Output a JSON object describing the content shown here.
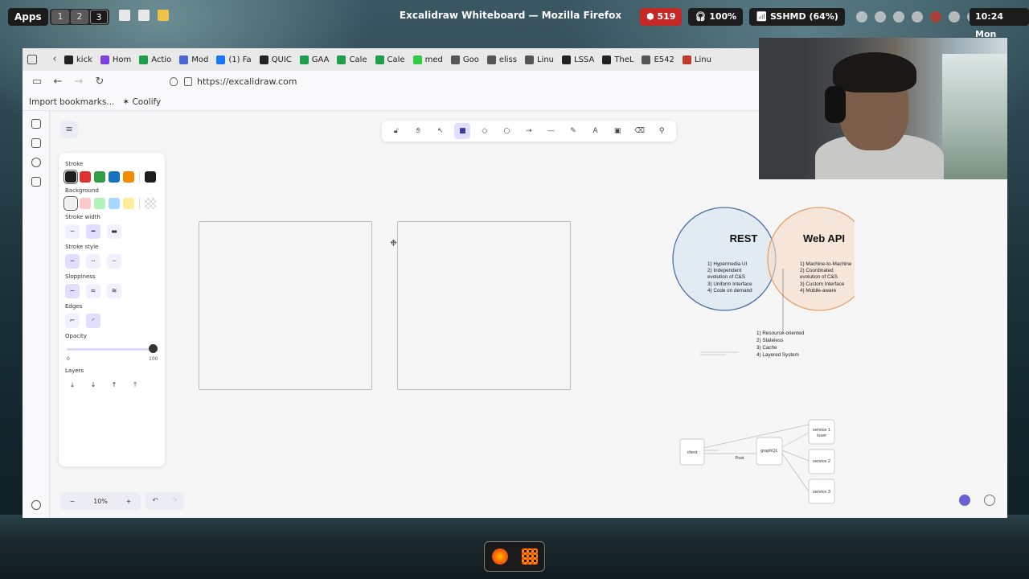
{
  "system": {
    "apps_label": "Apps",
    "workspaces": [
      "1",
      "2",
      "3"
    ],
    "window_title": "Excalidraw Whiteboard — Mozilla Firefox",
    "badge_count": "519",
    "volume": "100%",
    "wifi": "SSHMD (64%)",
    "clock": "10:24 Mon"
  },
  "browser": {
    "bookmarks": [
      {
        "label": "kick",
        "color": "#222222"
      },
      {
        "label": "Hom",
        "color": "#7b3fe4"
      },
      {
        "label": "Actio",
        "color": "#1e9e4a"
      },
      {
        "label": "Mod",
        "color": "#4a67d6"
      },
      {
        "label": "(1) Fa",
        "color": "#1877f2"
      },
      {
        "label": "QUIC",
        "color": "#222222"
      },
      {
        "label": "GAA",
        "color": "#1e9e4a"
      },
      {
        "label": "Cale",
        "color": "#1e9e4a"
      },
      {
        "label": "Cale",
        "color": "#1e9e4a"
      },
      {
        "label": "med",
        "color": "#2ecc40"
      },
      {
        "label": "Goo",
        "color": "#555555"
      },
      {
        "label": "eliss",
        "color": "#555555"
      },
      {
        "label": "Linu",
        "color": "#555555"
      },
      {
        "label": "LSSA",
        "color": "#222222"
      },
      {
        "label": "TheL",
        "color": "#222222"
      },
      {
        "label": "E542",
        "color": "#555555"
      },
      {
        "label": "Linu",
        "color": "#c0392b"
      }
    ],
    "url": "https://excalidraw.com",
    "bookmark_bar": [
      "Import bookmarks...",
      "Coolify"
    ]
  },
  "excalidraw": {
    "menu_icon": "≡",
    "tools": [
      {
        "name": "lock-tool",
        "glyph": "🔓︎",
        "active": false
      },
      {
        "name": "hand-tool",
        "glyph": "✋︎",
        "active": false
      },
      {
        "name": "selection-tool",
        "glyph": "↖",
        "active": false
      },
      {
        "name": "rectangle-tool",
        "glyph": "■",
        "active": true
      },
      {
        "name": "diamond-tool",
        "glyph": "◇",
        "active": false
      },
      {
        "name": "ellipse-tool",
        "glyph": "○",
        "active": false
      },
      {
        "name": "arrow-tool",
        "glyph": "→",
        "active": false
      },
      {
        "name": "line-tool",
        "glyph": "—",
        "active": false
      },
      {
        "name": "draw-tool",
        "glyph": "✎",
        "active": false
      },
      {
        "name": "text-tool",
        "glyph": "A",
        "active": false
      },
      {
        "name": "image-tool",
        "glyph": "▣",
        "active": false
      },
      {
        "name": "eraser-tool",
        "glyph": "⌫",
        "active": false
      },
      {
        "name": "extra-tool",
        "glyph": "⚲",
        "active": false
      }
    ],
    "properties": {
      "stroke_label": "Stroke",
      "stroke_colors": [
        "#1e1e1e",
        "#e03131",
        "#2f9e44",
        "#1971c2",
        "#f08c00"
      ],
      "stroke_current": "#1e1e1e",
      "background_label": "Background",
      "background_colors": [
        "#f0f0f0",
        "#ffc9c9",
        "#b2f2bb",
        "#a5d8ff",
        "#ffec99"
      ],
      "stroke_width_label": "Stroke width",
      "stroke_style_label": "Stroke style",
      "sloppiness_label": "Sloppiness",
      "edges_label": "Edges",
      "opacity_label": "Opacity",
      "opacity_min": "0",
      "opacity_max": "100",
      "opacity_value": 100,
      "layers_label": "Layers"
    },
    "zoom_level": "10%",
    "zoom_minus": "−",
    "zoom_plus": "+",
    "undo": "↶",
    "redo": "↷"
  },
  "diagram": {
    "rest_title": "REST",
    "rest_items": [
      "1) Hypermedia UI",
      "2) Independent",
      "evolution of C&S",
      "3) Uniform Interface",
      "4) Code on demand"
    ],
    "webapi_title": "Web API",
    "webapi_items": [
      "1) Machine-to-Machine",
      "2) Coordinated",
      "evolution of C&S",
      "3) Custom Interface",
      "4) Mobile-aware"
    ],
    "shared_items": [
      "1) Resource-oriented",
      "2) Stateless",
      "3) Cache",
      "4) Layered System"
    ],
    "rest_color": "#4a6fa5",
    "webapi_color": "#e8a06a",
    "graph": {
      "client": "client",
      "post": "Post",
      "graphql": "graphQL",
      "service1": "service 1",
      "service1_sub": "/user",
      "service2": "service 2",
      "service3": "service 3"
    }
  }
}
